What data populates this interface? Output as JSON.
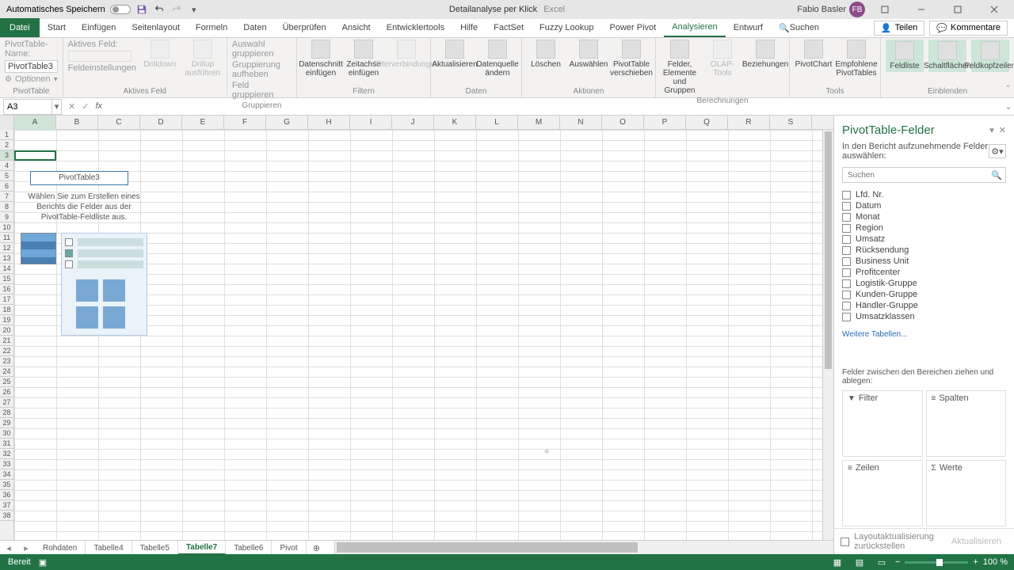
{
  "titlebar": {
    "autosave_label": "Automatisches Speichern",
    "doc_name": "Detailanalyse per Klick",
    "app_name": "Excel",
    "user_name": "Fabio Basler",
    "user_initials": "FB"
  },
  "tabs": {
    "file": "Datei",
    "items": [
      "Start",
      "Einfügen",
      "Seitenlayout",
      "Formeln",
      "Daten",
      "Überprüfen",
      "Ansicht",
      "Entwicklertools",
      "Hilfe",
      "FactSet",
      "Fuzzy Lookup",
      "Power Pivot",
      "Analysieren",
      "Entwurf"
    ],
    "active": "Analysieren",
    "search": "Suchen",
    "share": "Teilen",
    "comments": "Kommentare"
  },
  "ribbon": {
    "g1": {
      "name_lbl": "PivotTable-Name:",
      "name_val": "PivotTable3",
      "options": "Optionen",
      "label": "PivotTable"
    },
    "g2": {
      "active_field": "Aktives Feld:",
      "settings": "Feldeinstellungen",
      "drilldown": "Drilldown",
      "drillup": "Drillup ausführen",
      "label": "Aktives Feld"
    },
    "g3": {
      "sel": "Auswahl gruppieren",
      "ungrp": "Gruppierung aufheben",
      "fld": "Feld gruppieren",
      "label": "Gruppieren"
    },
    "g4": {
      "slicer": "Datenschnitt einfügen",
      "timeline": "Zeitachse einfügen",
      "conn": "Filterverbindungen",
      "label": "Filtern"
    },
    "g5": {
      "refresh": "Aktualisieren",
      "change": "Datenquelle ändern",
      "label": "Daten"
    },
    "g6": {
      "clear": "Löschen",
      "select": "Auswählen",
      "move": "PivotTable verschieben",
      "label": "Aktionen"
    },
    "g7": {
      "fields": "Felder, Elemente und Gruppen",
      "olap": "OLAP-Tools",
      "rel": "Beziehungen",
      "label": "Berechnungen"
    },
    "g8": {
      "chart": "PivotChart",
      "rec": "Empfohlene PivotTables",
      "label": "Tools"
    },
    "g9": {
      "list": "Feldliste",
      "btns": "Schaltflächen",
      "hdr": "Feldkopfzeilen",
      "label": "Einblenden"
    }
  },
  "namebox": "A3",
  "columns": [
    "A",
    "B",
    "C",
    "D",
    "E",
    "F",
    "G",
    "H",
    "I",
    "J",
    "K",
    "L",
    "M",
    "N",
    "O",
    "P",
    "Q",
    "R",
    "S"
  ],
  "rows_count": 38,
  "active_row": 3,
  "pivot_placeholder": {
    "title": "PivotTable3",
    "text": "Wählen Sie zum Erstellen eines Berichts die Felder aus der PivotTable-Feldliste aus."
  },
  "sheet_tabs": [
    "Rohdaten",
    "Tabelle4",
    "Tabelle5",
    "Tabelle7",
    "Tabelle6",
    "Pivot"
  ],
  "active_sheet": "Tabelle7",
  "pane": {
    "title": "PivotTable-Felder",
    "subtitle": "In den Bericht aufzunehmende Felder auswählen:",
    "search_placeholder": "Suchen",
    "fields": [
      "Lfd. Nr.",
      "Datum",
      "Monat",
      "Region",
      "Umsatz",
      "Rücksendung",
      "Business Unit",
      "Profitcenter",
      "Logistik-Gruppe",
      "Kunden-Gruppe",
      "Händler-Gruppe",
      "Umsatzklassen"
    ],
    "more": "Weitere Tabellen...",
    "drag_text": "Felder zwischen den Bereichen ziehen und ablegen:",
    "areas": {
      "filter": "Filter",
      "columns": "Spalten",
      "rows": "Zeilen",
      "values": "Werte"
    },
    "defer": "Layoutaktualisierung zurückstellen",
    "update": "Aktualisieren"
  },
  "status": {
    "ready": "Bereit",
    "zoom": "100 %"
  }
}
